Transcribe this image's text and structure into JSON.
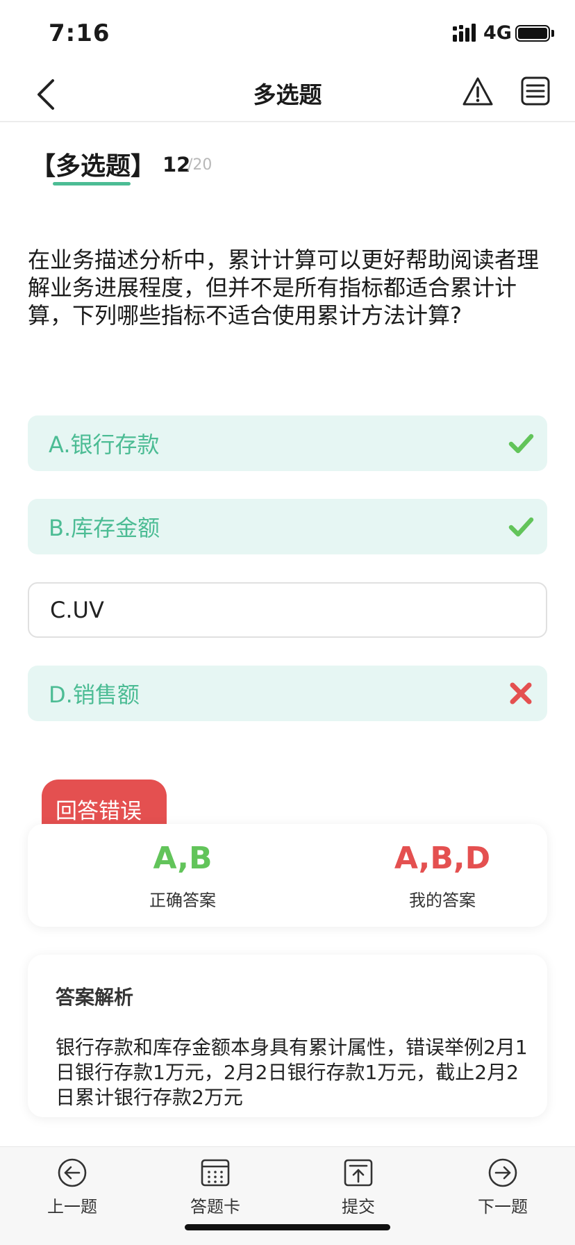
{
  "status_bar": {
    "time": "7:16",
    "network": "4G"
  },
  "nav": {
    "title": "多选题"
  },
  "question": {
    "type_label": "【多选题】",
    "index": "12",
    "total": "/20",
    "text": "在业务描述分析中，累计计算可以更好帮助阅读者理解业务进展程度，但并不是所有指标都适合累计计算，下列哪些指标不适合使用累计方法计算?"
  },
  "options": [
    {
      "label": "A.银行存款",
      "state": "correct-selected",
      "icon": "check-icon"
    },
    {
      "label": "B.库存金额",
      "state": "correct-selected",
      "icon": "check-icon"
    },
    {
      "label": "C.UV",
      "state": "unselected",
      "icon": ""
    },
    {
      "label": "D.销售额",
      "state": "wrong-selected",
      "icon": "cross-icon"
    }
  ],
  "result": {
    "badge": "回答错误",
    "correct_answer": "A,B",
    "correct_label": "正确答案",
    "my_answer": "A,B,D",
    "my_label": "我的答案"
  },
  "analysis": {
    "title": "答案解析",
    "text": "银行存款和库存金额本身具有累计属性，错误举例2月1日银行存款1万元，2月2日银行存款1万元，截止2月2日累计银行存款2万元"
  },
  "bottom_nav": [
    {
      "label": "上一题",
      "icon": "arrow-left-circle-icon"
    },
    {
      "label": "答题卡",
      "icon": "answer-sheet-icon"
    },
    {
      "label": "提交",
      "icon": "submit-icon"
    },
    {
      "label": "下一题",
      "icon": "arrow-right-circle-icon"
    }
  ],
  "colors": {
    "accent": "#4cbc94",
    "correct": "#62c45a",
    "wrong": "#e45050",
    "option_bg": "#e6f6f3"
  }
}
